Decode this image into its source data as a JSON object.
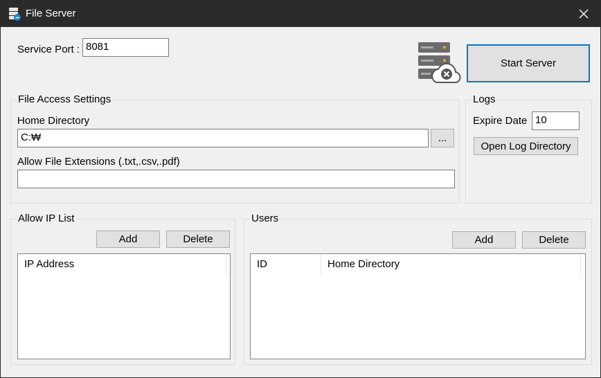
{
  "window": {
    "title": "File Server"
  },
  "service": {
    "port_label": "Service Port :",
    "port_value": "8081"
  },
  "start_button": "Start Server",
  "file_access": {
    "group_title": "File Access Settings",
    "home_dir_label": "Home Directory",
    "home_dir_value": "C:₩",
    "browse_label": "...",
    "extensions_label": "Allow File Extensions (.txt,.csv,.pdf)",
    "extensions_value": ""
  },
  "logs": {
    "group_title": "Logs",
    "expire_label": "Expire Date",
    "expire_value": "10",
    "open_dir_label": "Open Log Directory"
  },
  "ip_list": {
    "group_title": "Allow IP List",
    "add_label": "Add",
    "delete_label": "Delete",
    "columns": [
      "IP Address"
    ]
  },
  "users": {
    "group_title": "Users",
    "add_label": "Add",
    "delete_label": "Delete",
    "columns": [
      "ID",
      "Home Directory"
    ]
  },
  "icons": {
    "app": "server-icon",
    "status": "server-offline-icon",
    "close": "close-icon"
  }
}
